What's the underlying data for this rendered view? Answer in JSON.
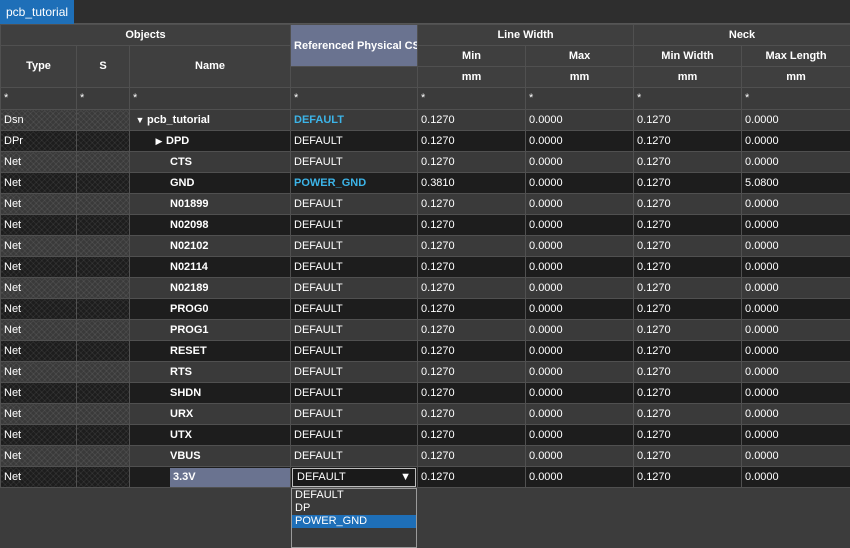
{
  "tab": {
    "label": "pcb_tutorial"
  },
  "headers": {
    "objects": "Objects",
    "ref_cset": "Referenced Physical CSet",
    "line_width": "Line Width",
    "neck": "Neck",
    "type": "Type",
    "s": "S",
    "name": "Name",
    "min": "Min",
    "max": "Max",
    "min_width": "Min Width",
    "max_length": "Max Length",
    "unit_min": "mm",
    "unit_max": "mm",
    "unit_min_width": "mm",
    "unit_max_length": "mm"
  },
  "filter": {
    "type": "*",
    "s": "*",
    "name": "*",
    "cset": "*",
    "min": "*",
    "max": "*",
    "min_width": "*",
    "max_length": "*"
  },
  "rows": [
    {
      "type": "Dsn",
      "name": "pcb_tutorial",
      "expander": "▼",
      "cset": "DEFAULT",
      "accent": true,
      "min": "0.1270",
      "max": "0.0000",
      "min_width": "0.1270",
      "max_length": "0.0000"
    },
    {
      "type": "DPr",
      "name": "DPD",
      "expander": "▶",
      "cset": "DEFAULT",
      "accent": false,
      "min": "0.1270",
      "max": "0.0000",
      "min_width": "0.1270",
      "max_length": "0.0000"
    },
    {
      "type": "Net",
      "name": "CTS",
      "expander": "",
      "cset": "DEFAULT",
      "accent": false,
      "min": "0.1270",
      "max": "0.0000",
      "min_width": "0.1270",
      "max_length": "0.0000"
    },
    {
      "type": "Net",
      "name": "GND",
      "expander": "",
      "cset": "POWER_GND",
      "accent": true,
      "min": "0.3810",
      "max": "0.0000",
      "min_width": "0.1270",
      "max_length": "5.0800"
    },
    {
      "type": "Net",
      "name": "N01899",
      "expander": "",
      "cset": "DEFAULT",
      "accent": false,
      "min": "0.1270",
      "max": "0.0000",
      "min_width": "0.1270",
      "max_length": "0.0000"
    },
    {
      "type": "Net",
      "name": "N02098",
      "expander": "",
      "cset": "DEFAULT",
      "accent": false,
      "min": "0.1270",
      "max": "0.0000",
      "min_width": "0.1270",
      "max_length": "0.0000"
    },
    {
      "type": "Net",
      "name": "N02102",
      "expander": "",
      "cset": "DEFAULT",
      "accent": false,
      "min": "0.1270",
      "max": "0.0000",
      "min_width": "0.1270",
      "max_length": "0.0000"
    },
    {
      "type": "Net",
      "name": "N02114",
      "expander": "",
      "cset": "DEFAULT",
      "accent": false,
      "min": "0.1270",
      "max": "0.0000",
      "min_width": "0.1270",
      "max_length": "0.0000"
    },
    {
      "type": "Net",
      "name": "N02189",
      "expander": "",
      "cset": "DEFAULT",
      "accent": false,
      "min": "0.1270",
      "max": "0.0000",
      "min_width": "0.1270",
      "max_length": "0.0000"
    },
    {
      "type": "Net",
      "name": "PROG0",
      "expander": "",
      "cset": "DEFAULT",
      "accent": false,
      "min": "0.1270",
      "max": "0.0000",
      "min_width": "0.1270",
      "max_length": "0.0000"
    },
    {
      "type": "Net",
      "name": "PROG1",
      "expander": "",
      "cset": "DEFAULT",
      "accent": false,
      "min": "0.1270",
      "max": "0.0000",
      "min_width": "0.1270",
      "max_length": "0.0000"
    },
    {
      "type": "Net",
      "name": "RESET",
      "expander": "",
      "cset": "DEFAULT",
      "accent": false,
      "min": "0.1270",
      "max": "0.0000",
      "min_width": "0.1270",
      "max_length": "0.0000"
    },
    {
      "type": "Net",
      "name": "RTS",
      "expander": "",
      "cset": "DEFAULT",
      "accent": false,
      "min": "0.1270",
      "max": "0.0000",
      "min_width": "0.1270",
      "max_length": "0.0000"
    },
    {
      "type": "Net",
      "name": "SHDN",
      "expander": "",
      "cset": "DEFAULT",
      "accent": false,
      "min": "0.1270",
      "max": "0.0000",
      "min_width": "0.1270",
      "max_length": "0.0000"
    },
    {
      "type": "Net",
      "name": "URX",
      "expander": "",
      "cset": "DEFAULT",
      "accent": false,
      "min": "0.1270",
      "max": "0.0000",
      "min_width": "0.1270",
      "max_length": "0.0000"
    },
    {
      "type": "Net",
      "name": "UTX",
      "expander": "",
      "cset": "DEFAULT",
      "accent": false,
      "min": "0.1270",
      "max": "0.0000",
      "min_width": "0.1270",
      "max_length": "0.0000"
    },
    {
      "type": "Net",
      "name": "VBUS",
      "expander": "",
      "cset": "DEFAULT",
      "accent": false,
      "min": "0.1270",
      "max": "0.0000",
      "min_width": "0.1270",
      "max_length": "0.0000"
    }
  ],
  "edit_row": {
    "type": "Net",
    "name": "3.3V",
    "cset": "DEFAULT",
    "min": "0.1270",
    "max": "0.0000",
    "min_width": "0.1270",
    "max_length": "0.0000"
  },
  "dropdown": {
    "options": [
      "DEFAULT",
      "DP",
      "POWER_GND"
    ],
    "selected": "POWER_GND"
  },
  "colors": {
    "accent": "#3cb4e8",
    "tab": "#1e6fb8",
    "header_highlight": "#6a7390"
  }
}
